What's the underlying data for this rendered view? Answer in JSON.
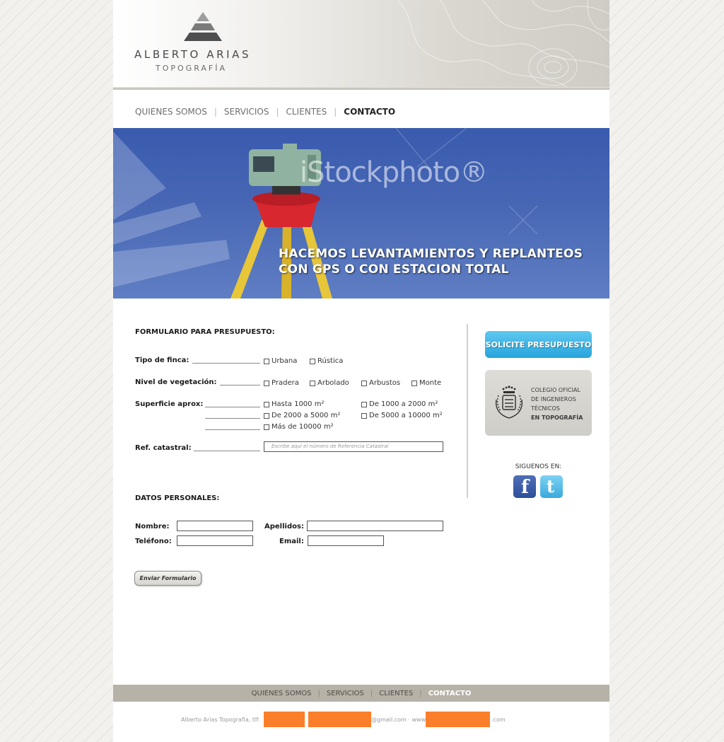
{
  "brand": {
    "name": "ALBERTO ARIAS",
    "subtitle": "TOPOGRAFÍA"
  },
  "nav": {
    "items": [
      "QUIENES SOMOS",
      "SERVICIOS",
      "CLIENTES",
      "CONTACTO"
    ],
    "active": "CONTACTO"
  },
  "hero": {
    "watermark": "iStockphoto®",
    "line1": "HACEMOS LEVANTAMIENTOS Y REPLANTEOS",
    "line2": "CON GPS O CON ESTACION TOTAL"
  },
  "form": {
    "title": "FORMULARIO PARA PRESUPUESTO:",
    "tipo_finca": {
      "label": "Tipo de finca:",
      "options": [
        "Urbana",
        "Rústica"
      ]
    },
    "vegetacion": {
      "label": "Nivel de vegetación:",
      "options": [
        "Pradera",
        "Arbolado",
        "Arbustos",
        "Monte"
      ]
    },
    "superficie": {
      "label": "Superficie aprox:",
      "options": [
        "Hasta 1000 m²",
        "De 1000 a 2000 m²",
        "De 2000 a 5000 m²",
        "De 5000 a 10000 m²",
        "Más de 10000 m²"
      ]
    },
    "ref_catastral": {
      "label": "Ref. catastral:",
      "placeholder": "Escribe aquí el número de Referencia Catastral",
      "value": ""
    },
    "personal_title": "DATOS PERSONALES:",
    "nombre_label": "Nombre:",
    "apellidos_label": "Apellidos:",
    "telefono_label": "Teléfono:",
    "email_label": "Email:",
    "submit_label": "Enviar Formulario"
  },
  "sidebar": {
    "quote_button": "SOLICITE PRESUPUESTO",
    "colegio": [
      "COLEGIO OFICIAL",
      "DE INGENIEROS",
      "TÉCNICOS",
      "EN TOPOGRAFÍA"
    ],
    "follow_label": "SIGUENOS EN:",
    "social": [
      "facebook-icon",
      "twitter-icon"
    ]
  },
  "footer": {
    "nav": [
      "QUIENES SOMOS",
      "SERVICIOS",
      "CLIENTES",
      "CONTACTO"
    ],
    "active": "CONTACTO",
    "info_prefix": "Alberto Arias Topografía,  tlf:",
    "email_suffix": "@gmail.com · www.",
    "web_suffix": ".com"
  },
  "colors": {
    "accent_blue": "#27a4dc",
    "redaction": "#fb7f2a",
    "footer_bar": "#b7b2a8"
  }
}
